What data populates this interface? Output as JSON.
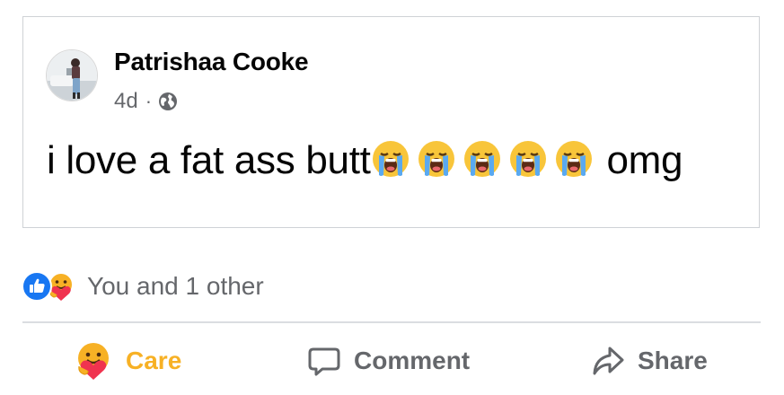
{
  "post": {
    "author": "Patrishaa Cooke",
    "time": "4d",
    "separator": "·",
    "audience_icon": "globe-icon",
    "text_before": "i love a fat ass butt",
    "emoji": "loudly-crying-face",
    "emoji_count": 5,
    "text_after": "omg"
  },
  "reactions": {
    "icons": [
      "like-icon",
      "care-icon"
    ],
    "summary": "You and 1 other"
  },
  "actions": {
    "care_label": "Care",
    "comment_label": "Comment",
    "share_label": "Share"
  },
  "colors": {
    "like_blue": "#1877f2",
    "care_yellow": "#f7b125",
    "secondary_text": "#65676b",
    "divider": "#dadde1"
  }
}
